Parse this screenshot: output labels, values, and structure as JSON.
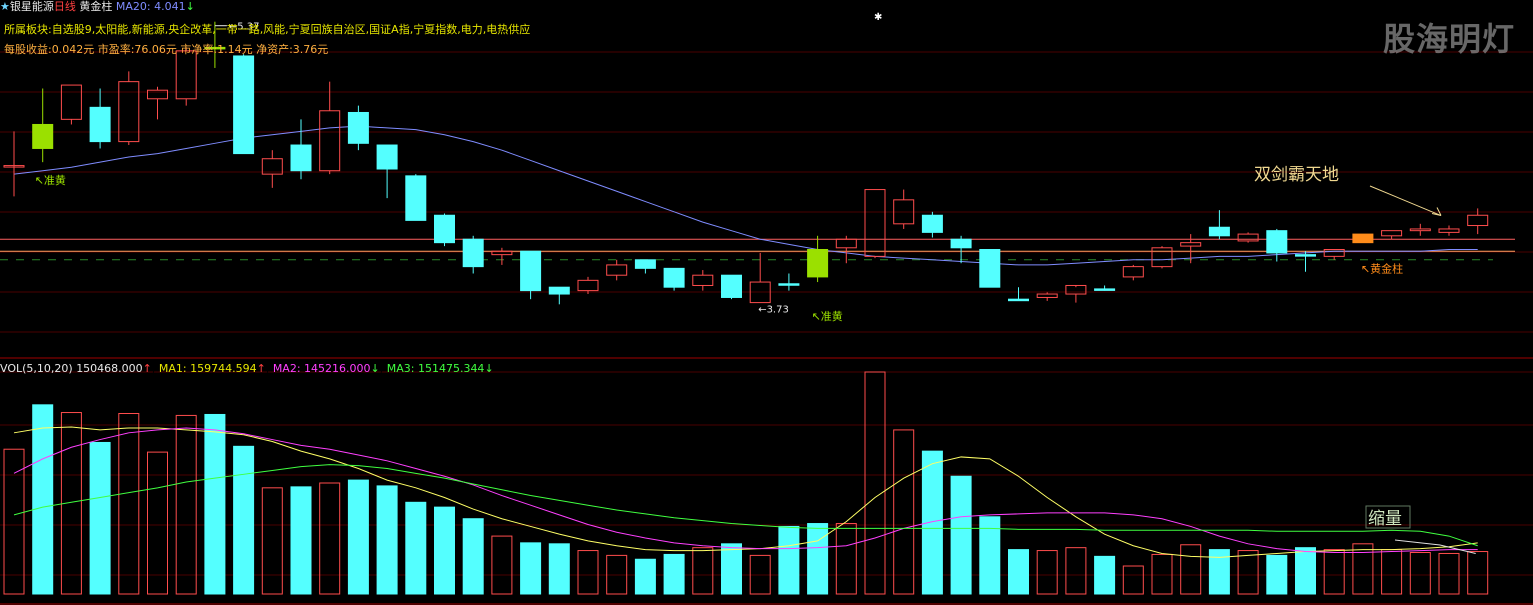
{
  "header": {
    "star": "★",
    "stock_name": "银星能源",
    "period": "日线",
    "indicator_name": "黄金柱",
    "ma20_label": "MA20: 4.041",
    "ma20_arrow": "↓",
    "sectors": "所属板块:自选股9,太阳能,新能源,央企改革,一带一路,风能,宁夏回族自治区,国证A指,宁夏指数,电力,电热供应",
    "fundamentals": "每股收益:0.042元 市盈率:76.06元 市净率:1.14元 净资产:3.76元"
  },
  "watermark": "股海明灯",
  "volume_header": {
    "label": "VOL(5,10,20)",
    "vol": "150468.000",
    "vol_arrow": "↑",
    "ma1": "MA1: 159744.594",
    "ma1_arrow": "↑",
    "ma2": "MA2: 145216.000",
    "ma2_arrow": "↓",
    "ma3": "MA3: 151475.344",
    "ma3_arrow": "↓"
  },
  "annotations": {
    "high_label": "5.37",
    "low_label": "3.73",
    "zhunhuang_1": "准黄",
    "zhunhuang_2": "准黄",
    "huangjinzhu": "黄金柱",
    "shuangjian": "双剑霸天地",
    "suoliang": "缩量"
  },
  "colors": {
    "up": "#ff4d4d",
    "down": "#54ffff",
    "zhunhuang": "#9be000",
    "golden": "#ff8c1a",
    "ma20": "#7f8cff",
    "vol_ma1": "#ffff66",
    "vol_ma2": "#ff40ff",
    "vol_ma3": "#40ff40"
  },
  "chart_data": {
    "type": "candlestick",
    "price_range": [
      3.5,
      5.45
    ],
    "reference_lines": [
      4.1,
      4.03
    ],
    "support_line": 3.98,
    "candles": [
      {
        "o": 4.53,
        "h": 4.73,
        "l": 4.35,
        "c": 4.53,
        "t": "up"
      },
      {
        "o": 4.77,
        "h": 4.98,
        "l": 4.55,
        "c": 4.63,
        "t": "zh"
      },
      {
        "o": 4.8,
        "h": 5.0,
        "l": 4.77,
        "c": 5.0,
        "t": "up"
      },
      {
        "o": 4.87,
        "h": 4.98,
        "l": 4.63,
        "c": 4.67,
        "t": "down"
      },
      {
        "o": 4.67,
        "h": 5.08,
        "l": 4.65,
        "c": 5.02,
        "t": "up"
      },
      {
        "o": 4.92,
        "h": 4.99,
        "l": 4.8,
        "c": 4.97,
        "t": "up"
      },
      {
        "o": 4.92,
        "h": 5.22,
        "l": 4.88,
        "c": 5.2,
        "t": "up"
      },
      {
        "o": 5.22,
        "h": 5.37,
        "l": 5.1,
        "c": 5.22,
        "t": "zh"
      },
      {
        "o": 5.17,
        "h": 5.18,
        "l": 4.6,
        "c": 4.6,
        "t": "down"
      },
      {
        "o": 4.48,
        "h": 4.62,
        "l": 4.4,
        "c": 4.57,
        "t": "up"
      },
      {
        "o": 4.65,
        "h": 4.8,
        "l": 4.45,
        "c": 4.5,
        "t": "down"
      },
      {
        "o": 4.5,
        "h": 5.02,
        "l": 4.48,
        "c": 4.85,
        "t": "up"
      },
      {
        "o": 4.84,
        "h": 4.88,
        "l": 4.62,
        "c": 4.66,
        "t": "down"
      },
      {
        "o": 4.65,
        "h": 4.65,
        "l": 4.34,
        "c": 4.51,
        "t": "down"
      },
      {
        "o": 4.47,
        "h": 4.48,
        "l": 4.21,
        "c": 4.21,
        "t": "down"
      },
      {
        "o": 4.24,
        "h": 4.25,
        "l": 4.06,
        "c": 4.08,
        "t": "down"
      },
      {
        "o": 4.1,
        "h": 4.12,
        "l": 3.9,
        "c": 3.94,
        "t": "down"
      },
      {
        "o": 4.01,
        "h": 4.05,
        "l": 3.95,
        "c": 4.03,
        "t": "up"
      },
      {
        "o": 4.03,
        "h": 4.03,
        "l": 3.75,
        "c": 3.8,
        "t": "down"
      },
      {
        "o": 3.82,
        "h": 3.82,
        "l": 3.72,
        "c": 3.78,
        "t": "down"
      },
      {
        "o": 3.8,
        "h": 3.88,
        "l": 3.78,
        "c": 3.86,
        "t": "up"
      },
      {
        "o": 3.89,
        "h": 3.98,
        "l": 3.86,
        "c": 3.95,
        "t": "up"
      },
      {
        "o": 3.98,
        "h": 3.98,
        "l": 3.9,
        "c": 3.93,
        "t": "down"
      },
      {
        "o": 3.93,
        "h": 3.93,
        "l": 3.8,
        "c": 3.82,
        "t": "down"
      },
      {
        "o": 3.83,
        "h": 3.92,
        "l": 3.8,
        "c": 3.89,
        "t": "up"
      },
      {
        "o": 3.89,
        "h": 3.89,
        "l": 3.75,
        "c": 3.76,
        "t": "down"
      },
      {
        "o": 3.73,
        "h": 4.02,
        "l": 3.73,
        "c": 3.85,
        "t": "up"
      },
      {
        "o": 3.84,
        "h": 3.9,
        "l": 3.8,
        "c": 3.84,
        "t": "down"
      },
      {
        "o": 4.04,
        "h": 4.12,
        "l": 3.85,
        "c": 3.88,
        "t": "zh"
      },
      {
        "o": 4.05,
        "h": 4.12,
        "l": 3.96,
        "c": 4.1,
        "t": "up"
      },
      {
        "o": 4.0,
        "h": 4.39,
        "l": 3.99,
        "c": 4.39,
        "t": "up"
      },
      {
        "o": 4.19,
        "h": 4.39,
        "l": 4.16,
        "c": 4.33,
        "t": "up"
      },
      {
        "o": 4.24,
        "h": 4.26,
        "l": 4.11,
        "c": 4.14,
        "t": "down"
      },
      {
        "o": 4.1,
        "h": 4.12,
        "l": 3.96,
        "c": 4.05,
        "t": "down"
      },
      {
        "o": 4.04,
        "h": 4.04,
        "l": 3.82,
        "c": 3.82,
        "t": "down"
      },
      {
        "o": 3.75,
        "h": 3.82,
        "l": 3.74,
        "c": 3.75,
        "t": "down"
      },
      {
        "o": 3.76,
        "h": 3.79,
        "l": 3.74,
        "c": 3.78,
        "t": "up"
      },
      {
        "o": 3.78,
        "h": 3.82,
        "l": 3.73,
        "c": 3.83,
        "t": "up"
      },
      {
        "o": 3.81,
        "h": 3.83,
        "l": 3.8,
        "c": 3.81,
        "t": "down"
      },
      {
        "o": 3.88,
        "h": 3.95,
        "l": 3.86,
        "c": 3.94,
        "t": "up"
      },
      {
        "o": 3.94,
        "h": 4.06,
        "l": 3.93,
        "c": 4.05,
        "t": "up"
      },
      {
        "o": 4.06,
        "h": 4.13,
        "l": 3.96,
        "c": 4.08,
        "t": "up"
      },
      {
        "o": 4.17,
        "h": 4.27,
        "l": 4.1,
        "c": 4.12,
        "t": "down"
      },
      {
        "o": 4.09,
        "h": 4.14,
        "l": 4.08,
        "c": 4.13,
        "t": "up"
      },
      {
        "o": 4.15,
        "h": 4.16,
        "l": 3.97,
        "c": 4.02,
        "t": "down"
      },
      {
        "o": 4.01,
        "h": 4.03,
        "l": 3.91,
        "c": 4.01,
        "t": "down"
      },
      {
        "o": 4.0,
        "h": 4.04,
        "l": 3.98,
        "c": 4.04,
        "t": "up"
      },
      {
        "o": 4.08,
        "h": 4.12,
        "l": 4.08,
        "c": 4.13,
        "t": "gold"
      },
      {
        "o": 4.12,
        "h": 4.15,
        "l": 4.1,
        "c": 4.15,
        "t": "up"
      },
      {
        "o": 4.15,
        "h": 4.19,
        "l": 4.12,
        "c": 4.16,
        "t": "up"
      },
      {
        "o": 4.14,
        "h": 4.18,
        "l": 4.12,
        "c": 4.16,
        "t": "up"
      },
      {
        "o": 4.18,
        "h": 4.28,
        "l": 4.13,
        "c": 4.24,
        "t": "up"
      }
    ],
    "ma20": [
      4.48,
      4.5,
      4.52,
      4.55,
      4.58,
      4.6,
      4.63,
      4.66,
      4.69,
      4.71,
      4.73,
      4.75,
      4.76,
      4.75,
      4.74,
      4.71,
      4.67,
      4.62,
      4.56,
      4.5,
      4.44,
      4.38,
      4.32,
      4.26,
      4.2,
      4.15,
      4.1,
      4.07,
      4.04,
      4.02,
      4.0,
      3.99,
      3.98,
      3.97,
      3.96,
      3.95,
      3.95,
      3.96,
      3.97,
      3.98,
      3.98,
      3.99,
      4.0,
      4.0,
      4.01,
      4.02,
      4.03,
      4.03,
      4.03,
      4.03,
      4.04,
      4.04
    ],
    "volume_range": [
      0,
      230000
    ],
    "volume": [
      150000,
      196000,
      188000,
      157000,
      187000,
      147000,
      185000,
      186000,
      153000,
      110000,
      111000,
      115000,
      118000,
      112000,
      95000,
      90000,
      78000,
      60000,
      53000,
      52000,
      45000,
      40000,
      36000,
      41000,
      48000,
      52000,
      40000,
      70000,
      73000,
      73000,
      230000,
      170000,
      148000,
      122000,
      80000,
      46000,
      45000,
      48000,
      39000,
      29000,
      41000,
      51000,
      46000,
      45000,
      40000,
      48000,
      46000,
      52000,
      46000,
      43000,
      42000,
      44000
    ],
    "vol_ma1": [
      167000,
      172000,
      173000,
      170000,
      172000,
      172000,
      170000,
      168000,
      165000,
      158000,
      148000,
      140000,
      130000,
      118000,
      110000,
      100000,
      88000,
      78000,
      70000,
      62000,
      55000,
      50000,
      46000,
      45000,
      45000,
      46000,
      47000,
      50000,
      55000,
      75000,
      100000,
      120000,
      135000,
      142000,
      140000,
      122000,
      100000,
      80000,
      62000,
      50000,
      42000,
      39000,
      38000,
      40000,
      42000,
      44000,
      45000,
      46000,
      46000,
      47000,
      49000,
      53000
    ],
    "vol_ma2": [
      125000,
      140000,
      152000,
      160000,
      167000,
      170000,
      172000,
      170000,
      166000,
      160000,
      154000,
      150000,
      144000,
      138000,
      130000,
      122000,
      113000,
      102000,
      92000,
      82000,
      72000,
      64000,
      58000,
      53000,
      50000,
      48000,
      47000,
      47000,
      48000,
      50000,
      58000,
      68000,
      75000,
      80000,
      82000,
      83000,
      84000,
      84000,
      84000,
      82000,
      78000,
      70000,
      60000,
      52000,
      47000,
      44000,
      43000,
      43000,
      44000,
      45000,
      46000,
      46000
    ],
    "vol_ma3": [
      82000,
      90000,
      95000,
      100000,
      105000,
      110000,
      116000,
      120000,
      124000,
      128000,
      132000,
      134000,
      133000,
      130000,
      125000,
      120000,
      114000,
      108000,
      102000,
      97000,
      92000,
      87000,
      83000,
      79000,
      76000,
      73000,
      71000,
      69000,
      68000,
      68000,
      68000,
      68000,
      68000,
      68000,
      68000,
      67000,
      67000,
      67000,
      66000,
      66000,
      66000,
      66000,
      66000,
      66000,
      65000,
      65000,
      65000,
      65000,
      66000,
      65000,
      60000,
      50000
    ]
  }
}
